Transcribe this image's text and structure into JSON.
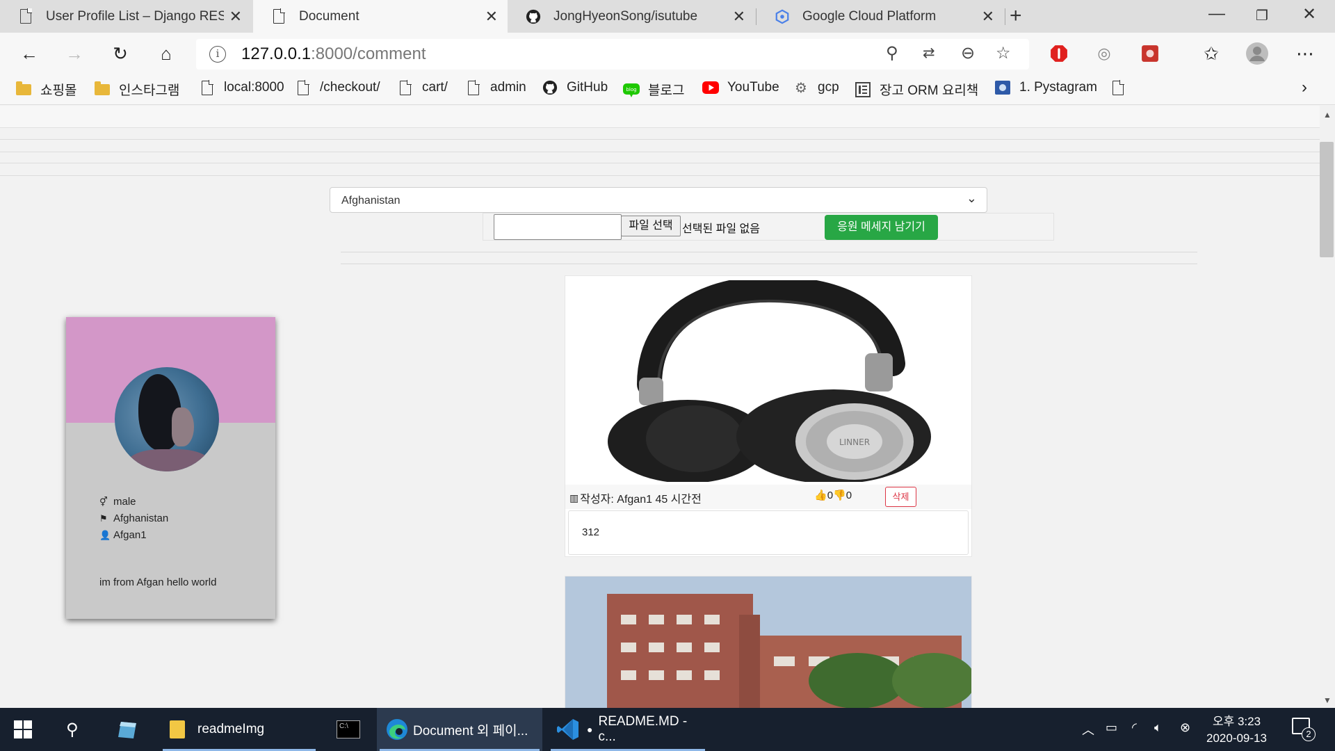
{
  "tabs": [
    {
      "title": "User Profile List – Django REST fr",
      "icon": "page-icon"
    },
    {
      "title": "Document",
      "icon": "page-icon",
      "active": true
    },
    {
      "title": "JongHyeonSong/isutube",
      "icon": "github-icon"
    },
    {
      "title": "Google Cloud Platform",
      "icon": "gcp-icon"
    }
  ],
  "address": {
    "host": "127.0.0.1",
    "rest": ":8000/comment"
  },
  "bookmarks": [
    {
      "label": "쇼핑몰",
      "icon": "folder-icon"
    },
    {
      "label": "인스타그램",
      "icon": "folder-icon"
    },
    {
      "label": "local:8000",
      "icon": "page-icon"
    },
    {
      "label": "/checkout/",
      "icon": "page-icon"
    },
    {
      "label": "cart/",
      "icon": "page-icon"
    },
    {
      "label": "admin",
      "icon": "page-icon"
    },
    {
      "label": "GitHub",
      "icon": "github-icon"
    },
    {
      "label": "블로그",
      "icon": "blog-icon"
    },
    {
      "label": "YouTube",
      "icon": "youtube-icon"
    },
    {
      "label": "gcp",
      "icon": "gcp-icon"
    },
    {
      "label": "장고 ORM 요리책",
      "icon": "book-icon"
    },
    {
      "label": "1. Pystagram",
      "icon": "pystagram-icon"
    }
  ],
  "form": {
    "country_selected": "Afghanistan",
    "file_button": "파일 선택",
    "file_status": "선택된 파일 없음",
    "submit_label": "응원 메세지 남기기"
  },
  "profile": {
    "gender": "male",
    "country": "Afghanistan",
    "username": "Afgan1",
    "bio": "im from Afgan hello world",
    "banner_color": "#d397c8"
  },
  "comment": {
    "author_line": "작성자: Afgan1 45 시간전",
    "likes": "0",
    "dislikes": "0",
    "delete_label": "삭제",
    "body": "312",
    "image_brand": "LINNER"
  },
  "taskbar": {
    "items": [
      {
        "label": "readmeImg",
        "icon": "folder-icon"
      },
      {
        "label": "",
        "icon": "terminal-icon"
      },
      {
        "label": "Document 외 페이...",
        "icon": "edge-icon"
      },
      {
        "label": "README.MD - c...",
        "icon": "vscode-icon"
      }
    ],
    "time": "오후 3:23",
    "date": "2020-09-13",
    "notifications": "2"
  }
}
